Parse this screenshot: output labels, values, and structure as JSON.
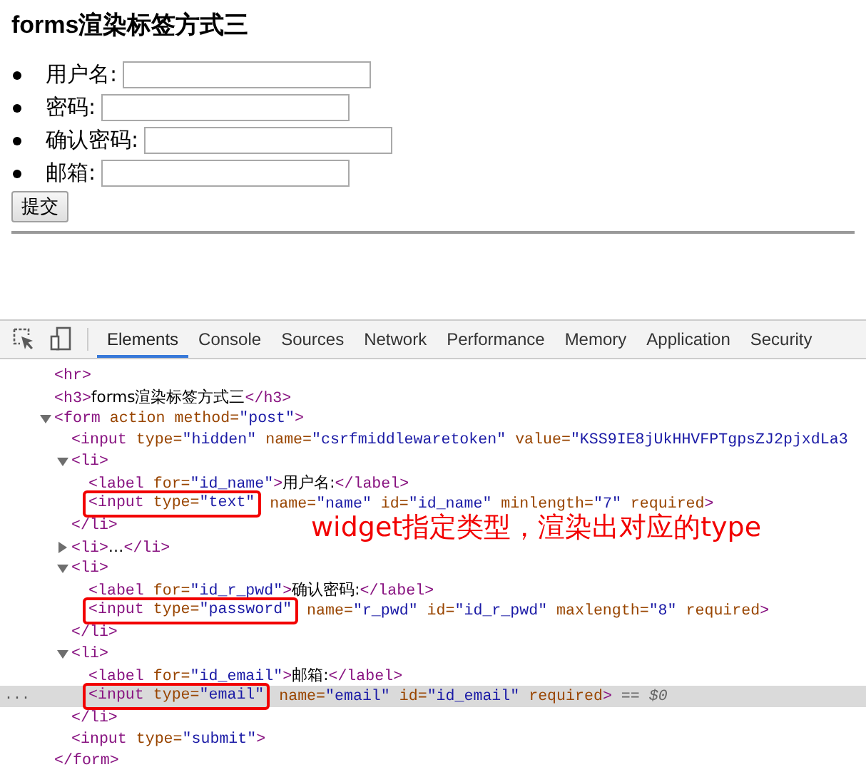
{
  "page": {
    "heading": "forms渲染标签方式三",
    "fields": [
      {
        "label": "用户名:"
      },
      {
        "label": "密码:"
      },
      {
        "label": "确认密码:"
      },
      {
        "label": "邮箱:"
      }
    ],
    "submit": "提交"
  },
  "devtools": {
    "tabs": [
      {
        "label": "Elements",
        "selected": true
      },
      {
        "label": "Console",
        "selected": false
      },
      {
        "label": "Sources",
        "selected": false
      },
      {
        "label": "Network",
        "selected": false
      },
      {
        "label": "Performance",
        "selected": false
      },
      {
        "label": "Memory",
        "selected": false
      },
      {
        "label": "Application",
        "selected": false
      },
      {
        "label": "Security",
        "selected": false
      }
    ],
    "dom_tree": [
      {
        "selected": false,
        "tokens": [
          {
            "kind": "tag",
            "text": "<hr>"
          }
        ]
      },
      {
        "selected": false,
        "tokens": [
          {
            "kind": "tag",
            "text": "<h3>"
          },
          {
            "kind": "text",
            "text": "forms渲染标签方式三"
          },
          {
            "kind": "tag",
            "text": "</h3>"
          }
        ]
      },
      {
        "selected": false,
        "expanded": true,
        "tokens": [
          {
            "kind": "tag",
            "text": "<form"
          },
          {
            "kind": "attr",
            "text": " action"
          },
          {
            "kind": "attr",
            "text": " method="
          },
          {
            "kind": "value",
            "text": "\"post\""
          },
          {
            "kind": "tag",
            "text": ">"
          }
        ],
        "children": [
          {
            "selected": false,
            "tokens": [
              {
                "kind": "tag",
                "text": "<input"
              },
              {
                "kind": "attr",
                "text": " type="
              },
              {
                "kind": "value",
                "text": "\"hidden\""
              },
              {
                "kind": "attr",
                "text": " name="
              },
              {
                "kind": "value",
                "text": "\"csrfmiddlewaretoken\""
              },
              {
                "kind": "attr",
                "text": " value="
              },
              {
                "kind": "value",
                "text": "\"KSS9IE8jUkHHVFPTgpsZJ2pjxdLa3"
              }
            ]
          },
          {
            "selected": false,
            "expanded": true,
            "tokens": [
              {
                "kind": "tag",
                "text": "<li>"
              }
            ],
            "children": [
              {
                "selected": false,
                "tokens": [
                  {
                    "kind": "tag",
                    "text": "<label"
                  },
                  {
                    "kind": "attr",
                    "text": " for="
                  },
                  {
                    "kind": "value",
                    "text": "\"id_name\""
                  },
                  {
                    "kind": "tag",
                    "text": ">"
                  },
                  {
                    "kind": "text",
                    "text": "用户名:"
                  },
                  {
                    "kind": "tag",
                    "text": "</label>"
                  }
                ]
              },
              {
                "selected": false,
                "boxed": [
                  {
                    "kind": "tag",
                    "text": "<input"
                  },
                  {
                    "kind": "attr",
                    "text": " type="
                  },
                  {
                    "kind": "value",
                    "text": "\"text\""
                  }
                ],
                "tokens": [
                  {
                    "kind": "attr",
                    "text": " name="
                  },
                  {
                    "kind": "value",
                    "text": "\"name\""
                  },
                  {
                    "kind": "attr",
                    "text": " id="
                  },
                  {
                    "kind": "value",
                    "text": "\"id_name\""
                  },
                  {
                    "kind": "attr",
                    "text": " minlength="
                  },
                  {
                    "kind": "value",
                    "text": "\"7\""
                  },
                  {
                    "kind": "attr",
                    "text": " required"
                  },
                  {
                    "kind": "tag",
                    "text": ">"
                  }
                ]
              }
            ],
            "closing": [
              {
                "kind": "tag",
                "text": "</li>"
              }
            ]
          },
          {
            "selected": false,
            "expanded": false,
            "tokens": [
              {
                "kind": "tag",
                "text": "<li>"
              },
              {
                "kind": "text",
                "text": "…"
              },
              {
                "kind": "tag",
                "text": "</li>"
              }
            ]
          },
          {
            "selected": false,
            "expanded": true,
            "tokens": [
              {
                "kind": "tag",
                "text": "<li>"
              }
            ],
            "children": [
              {
                "selected": false,
                "tokens": [
                  {
                    "kind": "tag",
                    "text": "<label"
                  },
                  {
                    "kind": "attr",
                    "text": " for="
                  },
                  {
                    "kind": "value",
                    "text": "\"id_r_pwd\""
                  },
                  {
                    "kind": "tag",
                    "text": ">"
                  },
                  {
                    "kind": "text",
                    "text": "确认密码:"
                  },
                  {
                    "kind": "tag",
                    "text": "</label>"
                  }
                ]
              },
              {
                "selected": false,
                "boxed": [
                  {
                    "kind": "tag",
                    "text": "<input"
                  },
                  {
                    "kind": "attr",
                    "text": " type="
                  },
                  {
                    "kind": "value",
                    "text": "\"password\""
                  }
                ],
                "tokens": [
                  {
                    "kind": "attr",
                    "text": " name="
                  },
                  {
                    "kind": "value",
                    "text": "\"r_pwd\""
                  },
                  {
                    "kind": "attr",
                    "text": " id="
                  },
                  {
                    "kind": "value",
                    "text": "\"id_r_pwd\""
                  },
                  {
                    "kind": "attr",
                    "text": " maxlength="
                  },
                  {
                    "kind": "value",
                    "text": "\"8\""
                  },
                  {
                    "kind": "attr",
                    "text": " required"
                  },
                  {
                    "kind": "tag",
                    "text": ">"
                  }
                ]
              }
            ],
            "closing": [
              {
                "kind": "tag",
                "text": "</li>"
              }
            ]
          },
          {
            "selected": false,
            "expanded": true,
            "tokens": [
              {
                "kind": "tag",
                "text": "<li>"
              }
            ],
            "children": [
              {
                "selected": false,
                "tokens": [
                  {
                    "kind": "tag",
                    "text": "<label"
                  },
                  {
                    "kind": "attr",
                    "text": " for="
                  },
                  {
                    "kind": "value",
                    "text": "\"id_email\""
                  },
                  {
                    "kind": "tag",
                    "text": ">"
                  },
                  {
                    "kind": "text",
                    "text": "邮箱:"
                  },
                  {
                    "kind": "tag",
                    "text": "</label>"
                  }
                ]
              },
              {
                "selected": true,
                "gutter": "...",
                "boxed": [
                  {
                    "kind": "tag",
                    "text": "<input"
                  },
                  {
                    "kind": "attr",
                    "text": " type="
                  },
                  {
                    "kind": "value",
                    "text": "\"email\""
                  }
                ],
                "tokens": [
                  {
                    "kind": "attr",
                    "text": " name="
                  },
                  {
                    "kind": "value",
                    "text": "\"email\""
                  },
                  {
                    "kind": "attr",
                    "text": " id="
                  },
                  {
                    "kind": "value",
                    "text": "\"id_email\""
                  },
                  {
                    "kind": "attr",
                    "text": " required"
                  },
                  {
                    "kind": "tag",
                    "text": ">"
                  },
                  {
                    "kind": "note",
                    "text": " == $0"
                  }
                ]
              }
            ],
            "closing": [
              {
                "kind": "tag",
                "text": "</li>"
              }
            ]
          },
          {
            "selected": false,
            "tokens": [
              {
                "kind": "tag",
                "text": "<input"
              },
              {
                "kind": "attr",
                "text": " type="
              },
              {
                "kind": "value",
                "text": "\"submit\""
              },
              {
                "kind": "tag",
                "text": ">"
              }
            ]
          }
        ],
        "closing": [
          {
            "kind": "tag",
            "text": "</form>"
          }
        ]
      }
    ],
    "annotation": "widget指定类型，渲染出对应的type"
  }
}
